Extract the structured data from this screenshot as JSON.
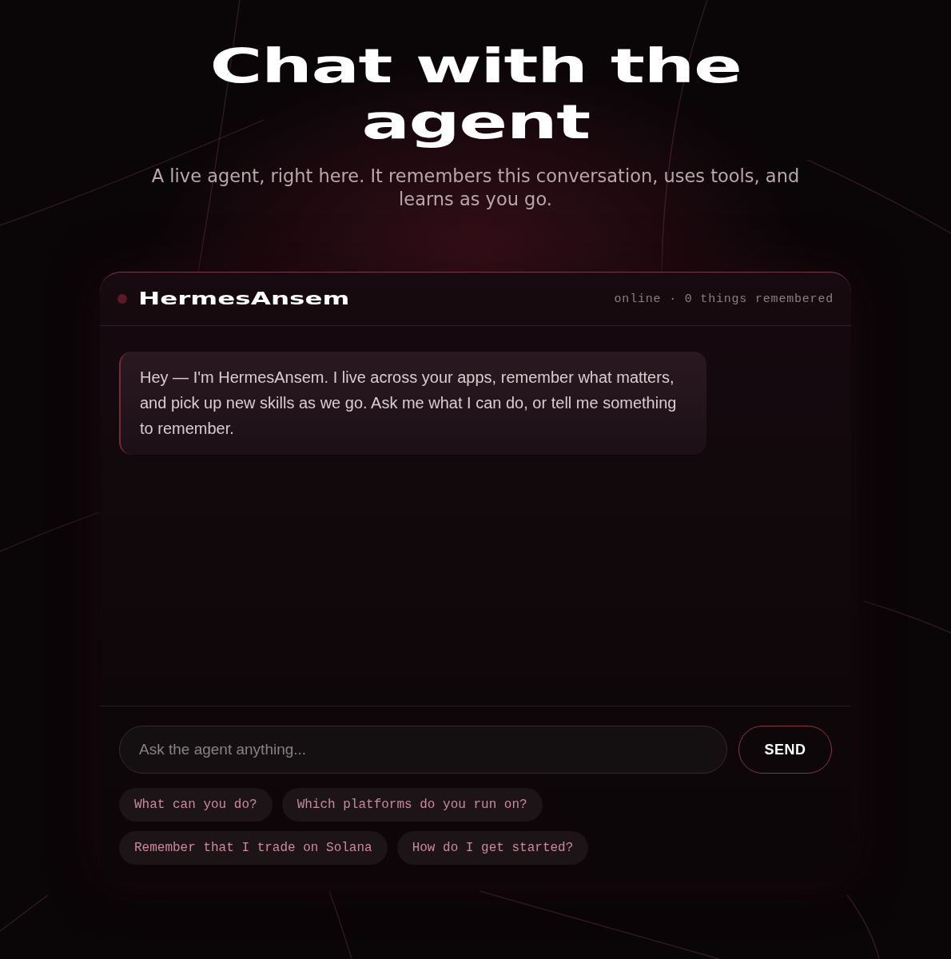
{
  "hero": {
    "title": "Chat with the agent",
    "subtitle": "A live agent, right here. It remembers this conversation, uses tools, and learns as you go."
  },
  "chat": {
    "agent_name": "HermesAnsem",
    "status": "online · 0 things remembered",
    "messages": [
      {
        "kind": "agent",
        "text": "Hey — I'm HermesAnsem. I live across your apps, remember what matters, and pick up new skills as we go. Ask me what I can do, or tell me something to remember."
      }
    ],
    "input": {
      "placeholder": "Ask the agent anything..."
    },
    "send_button": "SEND",
    "suggestions": [
      "What can you do?",
      "Which platforms do you run on?",
      "Remember that I trade on Solana",
      "How do I get started?"
    ]
  }
}
